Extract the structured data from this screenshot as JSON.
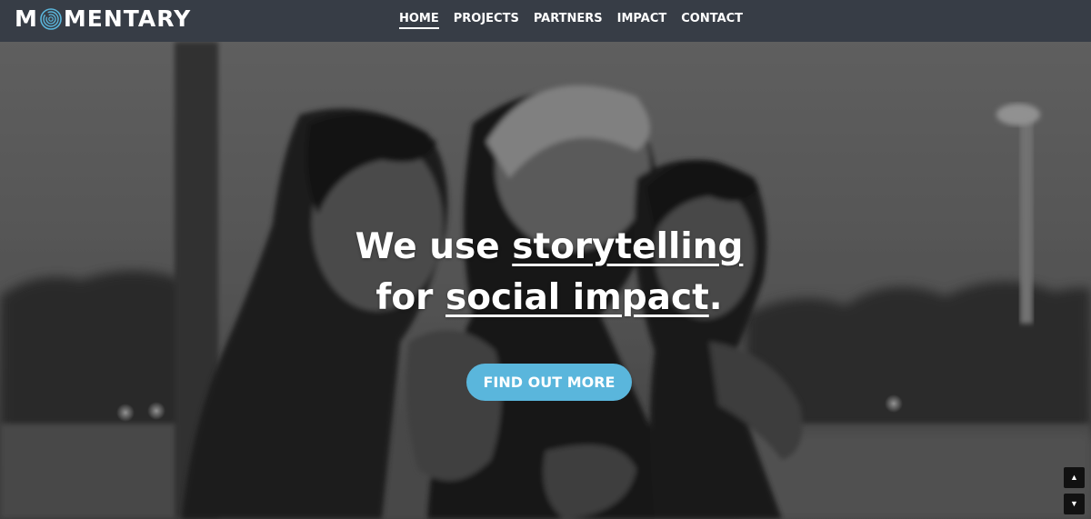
{
  "header": {
    "logo": {
      "before": "M",
      "after": "MENTARY",
      "icon": "fingerprint-icon"
    },
    "nav": [
      {
        "label": "HOME",
        "active": true
      },
      {
        "label": "PROJECTS",
        "active": false
      },
      {
        "label": "PARTNERS",
        "active": false
      },
      {
        "label": "IMPACT",
        "active": false
      },
      {
        "label": "CONTACT",
        "active": false
      }
    ],
    "background_color": "#373d46"
  },
  "hero": {
    "line1_prefix": "We use ",
    "line1_link": "storytelling",
    "line2_prefix": "for ",
    "line2_link": "social impact",
    "line2_suffix": ".",
    "cta_label": "FIND OUT MORE",
    "cta_color": "#5ab6dc",
    "photo_style": "black-and-white photo of three people embracing outdoors at dusk"
  },
  "scroll_controls": {
    "up_icon": "triangle-up-icon",
    "down_icon": "triangle-down-icon",
    "up_glyph": "▲",
    "down_glyph": "▼"
  }
}
